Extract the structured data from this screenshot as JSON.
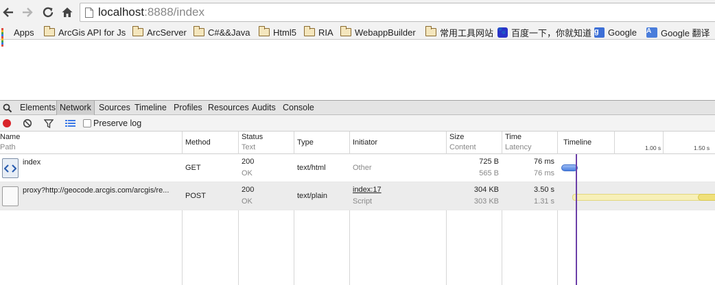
{
  "browser": {
    "url_host": "localhost",
    "url_rest": ":8888/index"
  },
  "bookmarks": [
    {
      "label": "Apps",
      "icon": "apps-grid-icon"
    },
    {
      "label": "ArcGis API for Js",
      "icon": "folder-icon"
    },
    {
      "label": "ArcServer",
      "icon": "folder-icon"
    },
    {
      "label": "C#&&Java",
      "icon": "folder-icon"
    },
    {
      "label": "Html5",
      "icon": "folder-icon"
    },
    {
      "label": "RIA",
      "icon": "folder-icon"
    },
    {
      "label": "WebappBuilder",
      "icon": "folder-icon"
    },
    {
      "label": "常用工具网站",
      "icon": "folder-icon"
    },
    {
      "label": "百度一下，你就知道",
      "icon": "baidu-icon"
    },
    {
      "label": "Google",
      "icon": "google-icon"
    },
    {
      "label": "Google 翻译",
      "icon": "google-translate-icon"
    }
  ],
  "devtools": {
    "tabs": [
      "Elements",
      "Network",
      "Sources",
      "Timeline",
      "Profiles",
      "Resources",
      "Audits",
      "Console"
    ],
    "selected_tab": "Network",
    "preserve_log_label": "Preserve log",
    "preserve_log_checked": false,
    "accent_record": "#d9242a",
    "columns": {
      "name": "Name",
      "path": "Path",
      "method": "Method",
      "status": "Status",
      "text": "Text",
      "type": "Type",
      "initiator": "Initiator",
      "size": "Size",
      "content": "Content",
      "time": "Time",
      "latency": "Latency",
      "timeline": "Timeline",
      "tick1": "1.00 s",
      "tick2": "1.50 s"
    },
    "requests": [
      {
        "name": "index",
        "method": "GET",
        "status": "200",
        "status_text": "OK",
        "type": "text/html",
        "initiator": "Other",
        "initiator_sub": "",
        "size": "725 B",
        "content": "565 B",
        "time": "76 ms",
        "latency": "76 ms",
        "icon": "html-document-icon"
      },
      {
        "name": "proxy?http://geocode.arcgis.com/arcgis/re...",
        "method": "POST",
        "status": "200",
        "status_text": "OK",
        "type": "text/plain",
        "initiator": "index:17",
        "initiator_sub": "Script",
        "size": "304 KB",
        "content": "303 KB",
        "time": "3.50 s",
        "latency": "1.31 s",
        "icon": "blank-document-icon"
      }
    ]
  }
}
